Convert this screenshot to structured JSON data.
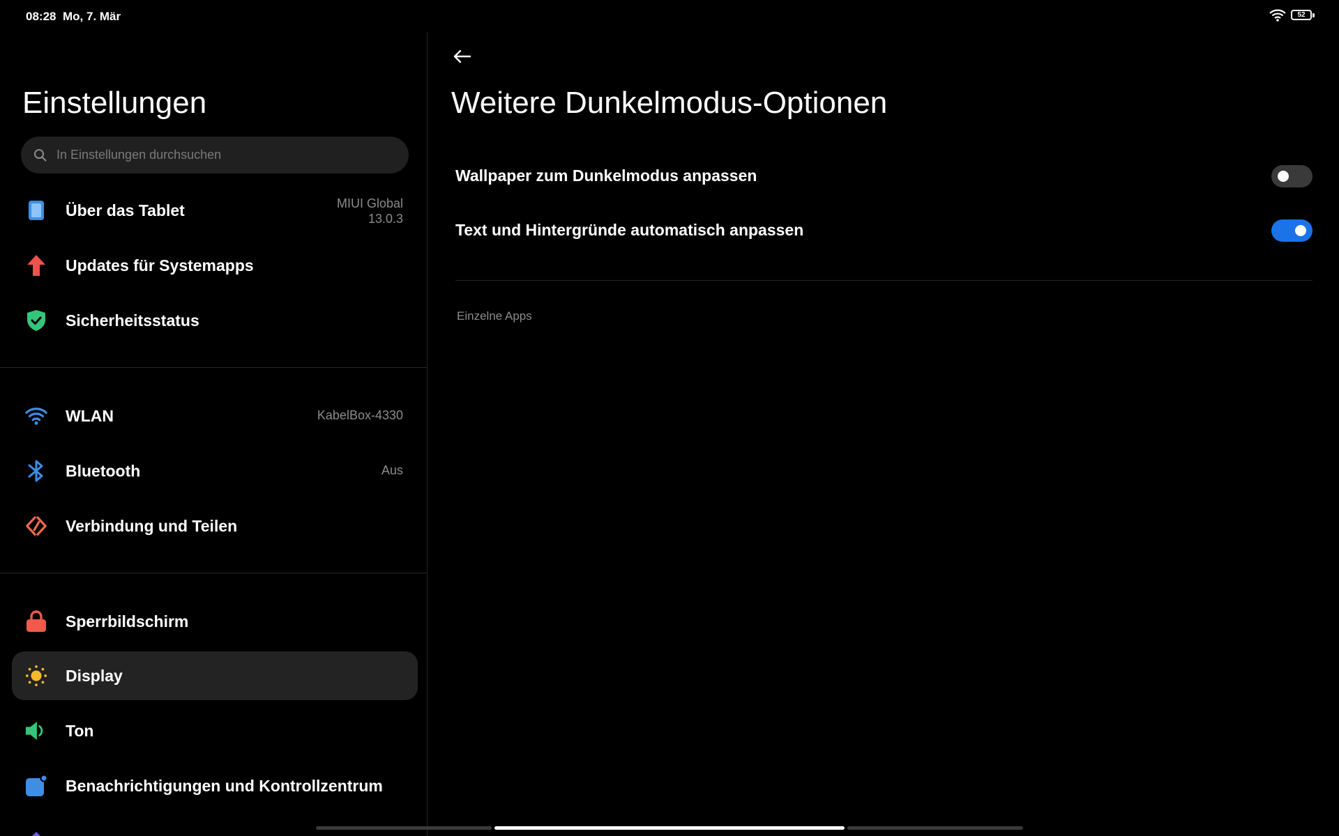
{
  "status": {
    "time": "08:28",
    "date": "Mo, 7. Mär",
    "battery": "52"
  },
  "sidebar": {
    "title": "Einstellungen",
    "search_placeholder": "In Einstellungen durchsuchen",
    "items": [
      {
        "label": "Über das Tablet",
        "value_line1": "MIUI Global",
        "value_line2": "13.0.3",
        "icon": "tablet-icon",
        "color": "#3d8fe6"
      },
      {
        "label": "Updates für Systemapps",
        "icon": "arrow-up-icon",
        "color": "#f0524b"
      },
      {
        "label": "Sicherheitsstatus",
        "icon": "shield-check-icon",
        "color": "#34c57a"
      },
      {
        "label": "WLAN",
        "value": "KabelBox-4330",
        "icon": "wifi-icon",
        "color": "#3d8fe6"
      },
      {
        "label": "Bluetooth",
        "value": "Aus",
        "icon": "bluetooth-icon",
        "color": "#3d8fe6"
      },
      {
        "label": "Verbindung und Teilen",
        "icon": "connection-share-icon",
        "color": "#f06a4b"
      },
      {
        "label": "Sperrbildschirm",
        "icon": "lock-icon",
        "color": "#f05a4b"
      },
      {
        "label": "Display",
        "icon": "sun-icon",
        "color": "#f5b82e",
        "active": true
      },
      {
        "label": "Ton",
        "icon": "speaker-icon",
        "color": "#34c57a"
      },
      {
        "label": "Benachrichtigungen und Kontrollzentrum",
        "icon": "notification-icon",
        "color": "#3d8fe6"
      }
    ]
  },
  "main": {
    "title": "Weitere Dunkelmodus-Optionen",
    "settings": [
      {
        "label": "Wallpaper zum Dunkelmodus anpassen",
        "enabled": false
      },
      {
        "label": "Text und Hintergründe automatisch anpassen",
        "enabled": true
      }
    ],
    "section_header": "Einzelne Apps"
  },
  "colors": {
    "background": "#000000",
    "toggle_on": "#1a73e8",
    "toggle_off": "#3a3a3a",
    "active_item": "#232323"
  }
}
